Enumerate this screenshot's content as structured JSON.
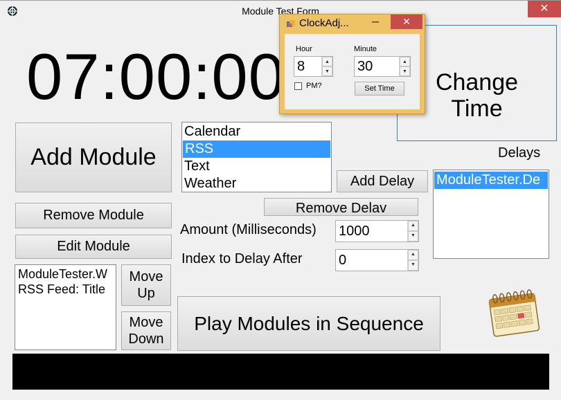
{
  "window": {
    "title": "Module Test Form",
    "close_symbol": "✕"
  },
  "clock": {
    "time": "07:00:00"
  },
  "buttons": {
    "change_time": "Change\nTime",
    "change_time_line1": "Change",
    "change_time_line2": "Time",
    "add_module": "Add Module",
    "remove_module": "Remove Module",
    "edit_module": "Edit Module",
    "move_up_1": "Move",
    "move_up_2": "Up",
    "move_down_1": "Move",
    "move_down_2": "Down",
    "add_delay": "Add Delay",
    "remove_delay": "Remove Delav",
    "play": "Play Modules in Sequence"
  },
  "module_types": {
    "items": [
      "Calendar",
      "RSS",
      "Text",
      "Weather"
    ],
    "selected": "RSS"
  },
  "labels": {
    "delays": "Delays",
    "amount": "Amount (Milliseconds)",
    "index": "Index to Delay After"
  },
  "inputs": {
    "amount": "1000",
    "index": "0"
  },
  "delays_list": {
    "items": [
      "ModuleTester.De"
    ]
  },
  "modules_list": {
    "items": [
      "ModuleTester.W",
      "RSS Feed: Title"
    ]
  },
  "dialog": {
    "title": "ClockAdj...",
    "hour_label": "Hour",
    "minute_label": "Minute",
    "hour_value": "8",
    "minute_value": "30",
    "pm_label": "PM?",
    "pm_checked": false,
    "set_time": "Set Time",
    "min_symbol": "─",
    "close_symbol": "✕"
  },
  "colors": {
    "selection": "#3399ff",
    "dialog_frame": "#eec267",
    "close_red": "#c74c4c"
  }
}
